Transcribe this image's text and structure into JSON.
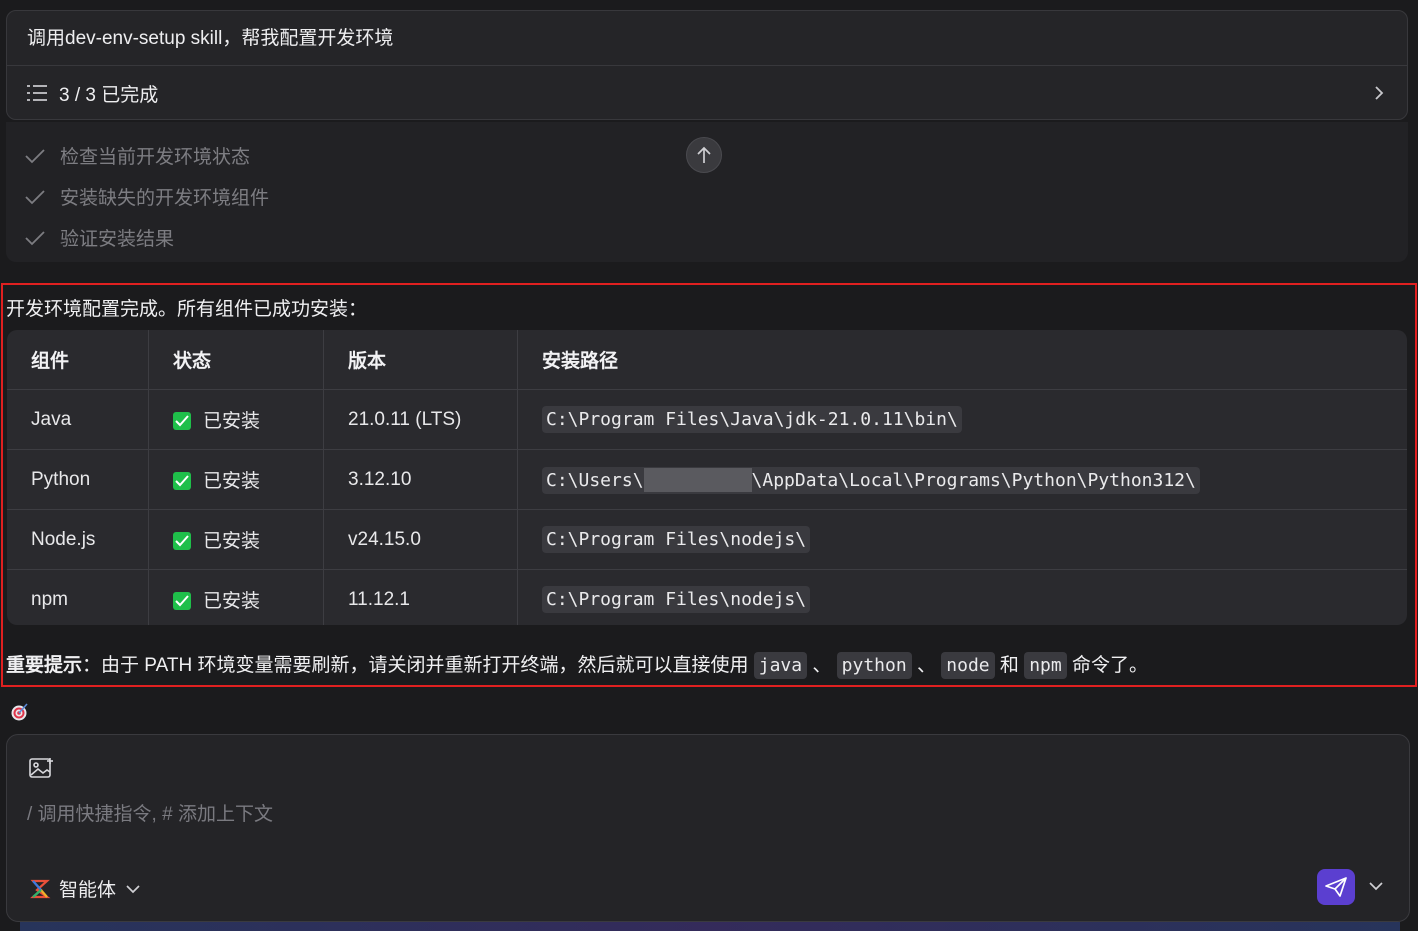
{
  "header": {
    "prompt": "调用dev-env-setup skill，帮我配置开发环境",
    "progress": "3 / 3 已完成"
  },
  "tasks": [
    {
      "label": "检查当前开发环境状态"
    },
    {
      "label": "安装缺失的开发环境组件"
    },
    {
      "label": "验证安装结果"
    }
  ],
  "summary": "开发环境配置完成。所有组件已成功安装：",
  "table": {
    "headers": [
      "组件",
      "状态",
      "版本",
      "安装路径"
    ],
    "rows": [
      {
        "component": "Java",
        "status": "已安装",
        "version": "21.0.11 (LTS)",
        "path": "C:\\Program Files\\Java\\jdk-21.0.11\\bin\\",
        "path_prefix": "",
        "path_suffix": ""
      },
      {
        "component": "Python",
        "status": "已安装",
        "version": "3.12.10",
        "path": "",
        "path_prefix": "C:\\Users\\",
        "path_suffix": "\\AppData\\Local\\Programs\\Python\\Python312\\"
      },
      {
        "component": "Node.js",
        "status": "已安装",
        "version": "v24.15.0",
        "path": "C:\\Program Files\\nodejs\\",
        "path_prefix": "",
        "path_suffix": ""
      },
      {
        "component": "npm",
        "status": "已安装",
        "version": "11.12.1",
        "path": "C:\\Program Files\\nodejs\\",
        "path_prefix": "",
        "path_suffix": ""
      }
    ]
  },
  "tip": {
    "label": "重要提示",
    "colon": "：",
    "text": "由于 PATH 环境变量需要刷新，请关闭并重新打开终端，然后就可以直接使用",
    "cmd1": "java",
    "sep1": "、",
    "cmd2": "python",
    "sep2": "、",
    "cmd3": "node",
    "and": "和",
    "cmd4": "npm",
    "end": "命令了。"
  },
  "composer": {
    "placeholder": "/ 调用快捷指令, # 添加上下文",
    "agent_label": "智能体"
  },
  "icons": {
    "list": "list-icon",
    "check": "check-icon",
    "scroll_up": "arrow-up-icon",
    "target": "target-icon",
    "image": "image-add-icon",
    "send": "send-icon"
  },
  "colors": {
    "accent": "#5b3fd0",
    "success": "#1fbf4a",
    "highlight_border": "#e02020"
  }
}
